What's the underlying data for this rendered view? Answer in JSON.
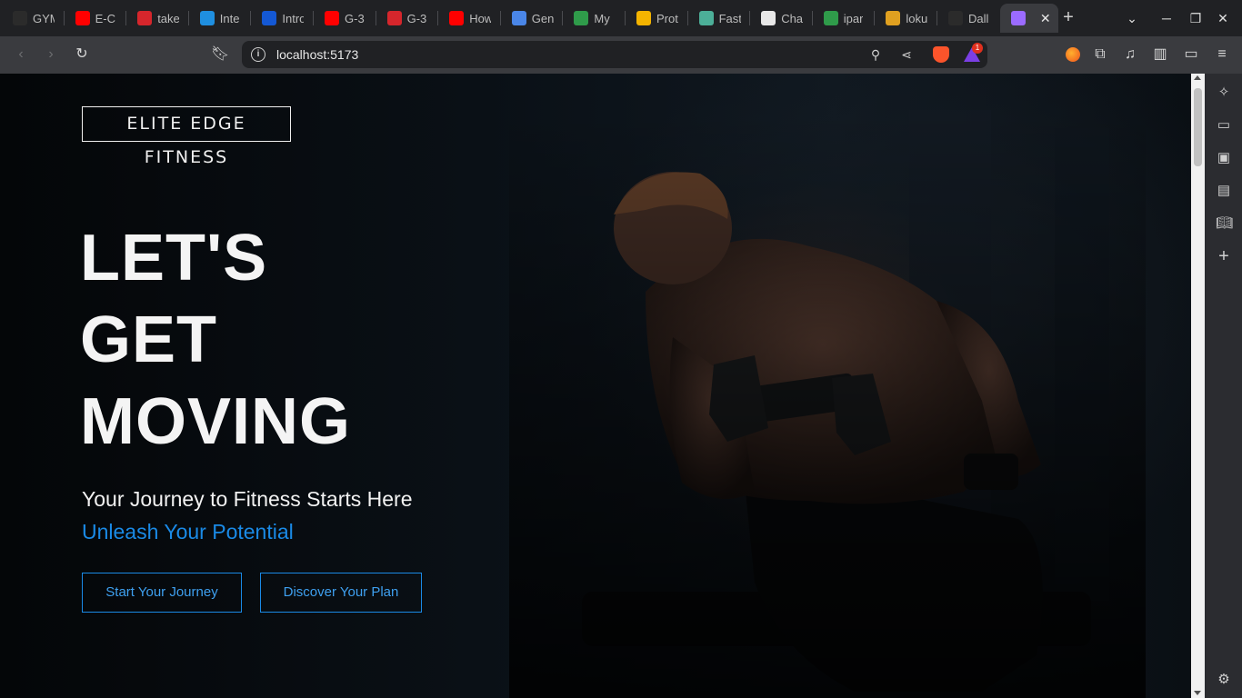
{
  "browser": {
    "tabs": [
      {
        "title": "GYM",
        "icon": "github-icon",
        "color": "#2b2b2b"
      },
      {
        "title": "E-C",
        "icon": "youtube-icon",
        "color": "#ff0000"
      },
      {
        "title": "take",
        "icon": "tuf-icon",
        "color": "#d6262c"
      },
      {
        "title": "Inte",
        "icon": "is-icon",
        "color": "#1f8fe0"
      },
      {
        "title": "Intro",
        "icon": "c-icon",
        "color": "#1458d4"
      },
      {
        "title": "G-3",
        "icon": "youtube-icon",
        "color": "#ff0000"
      },
      {
        "title": "G-3",
        "icon": "tuf-icon",
        "color": "#d6262c"
      },
      {
        "title": "How",
        "icon": "youtube-icon",
        "color": "#ff0000"
      },
      {
        "title": "Gen",
        "icon": "docs-icon",
        "color": "#4a86e8"
      },
      {
        "title": "My",
        "icon": "mongodb-icon",
        "color": "#2f9b4a"
      },
      {
        "title": "Prot",
        "icon": "chart-icon",
        "color": "#f4b400"
      },
      {
        "title": "Fast",
        "icon": "mountain-icon",
        "color": "#4caf98"
      },
      {
        "title": "Cha",
        "icon": "openai-icon",
        "color": "#e8e8e8"
      },
      {
        "title": "ipar",
        "icon": "link-icon",
        "color": "#2f9b4a"
      },
      {
        "title": "loku",
        "icon": "tool-icon",
        "color": "#e0a020"
      },
      {
        "title": "Dall",
        "icon": "github-icon",
        "color": "#2b2b2b"
      },
      {
        "title": "",
        "icon": "vite-icon",
        "color": "#9b6bff",
        "active": true
      }
    ],
    "new_tab_symbol": "+",
    "address": "localhost:5173",
    "notification_count": "1"
  },
  "hero": {
    "logo": "ELITE EDGE FITNESS",
    "headline": [
      "LET'S",
      "GET",
      "MOVING"
    ],
    "tagline": "Your Journey to Fitness Starts Here",
    "subtagline": "Unleash Your Potential",
    "primary_cta": "Start Your Journey",
    "secondary_cta": "Discover Your Plan"
  },
  "colors": {
    "accent": "#1a8ae6",
    "page_bg": "#070b10",
    "text": "#f4f4f4"
  }
}
